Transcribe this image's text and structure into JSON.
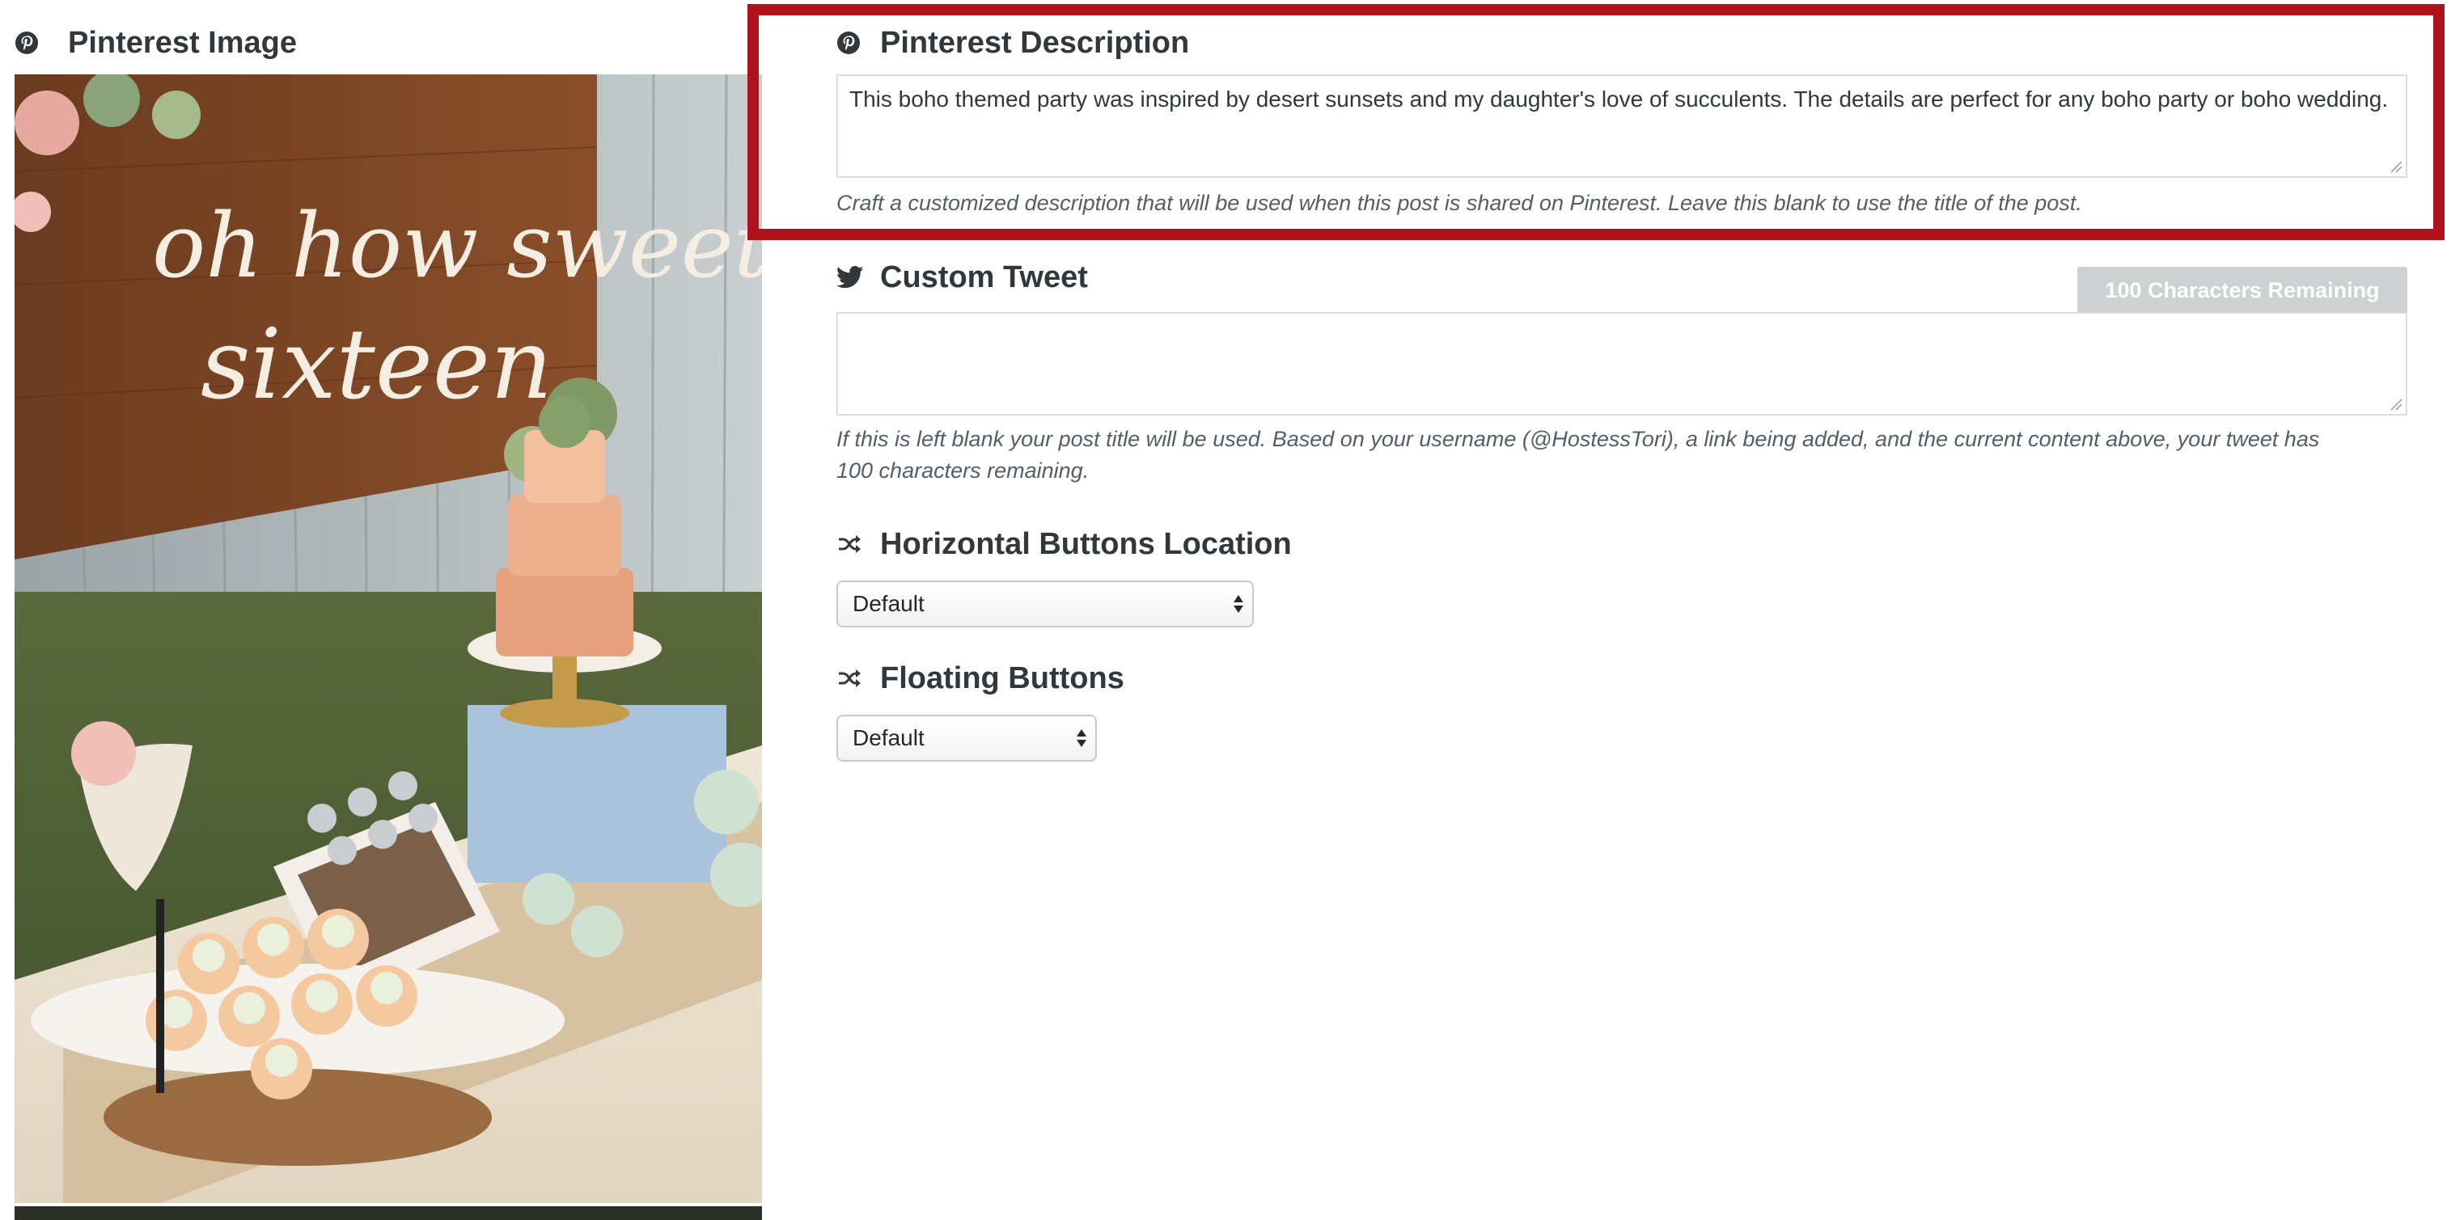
{
  "pinterest_image": {
    "label": "Pinterest Image",
    "image": {
      "sign_text_line1": "oh how sweet",
      "sign_text_line2": "sixteen"
    }
  },
  "pinterest_description": {
    "label": "Pinterest Description",
    "value": "This boho themed party was inspired by desert sunsets and my daughter's love of succulents. The details are perfect for any boho party or boho wedding.",
    "help": "Craft a customized description that will be used when this post is shared on Pinterest. Leave this blank to use the title of the post."
  },
  "custom_tweet": {
    "label": "Custom Tweet",
    "remaining": "100 Characters Remaining",
    "value": "",
    "help_line1": "If this is left blank your post title will be used. Based on your username (@HostessTori), a link being added, and the current content above, your tweet has",
    "help_line2": "100 characters remaining."
  },
  "horizontal_buttons": {
    "label": "Horizontal Buttons Location",
    "selected": "Default"
  },
  "floating_buttons": {
    "label": "Floating Buttons",
    "selected": "Default"
  },
  "icons": {
    "pinterest": "pinterest-icon",
    "twitter": "twitter-icon",
    "shuffle": "shuffle-icon"
  },
  "colors": {
    "highlight": "#b0121b",
    "heading": "#32373c",
    "help_text": "#555d66",
    "badge_bg": "#cfd0d2"
  }
}
